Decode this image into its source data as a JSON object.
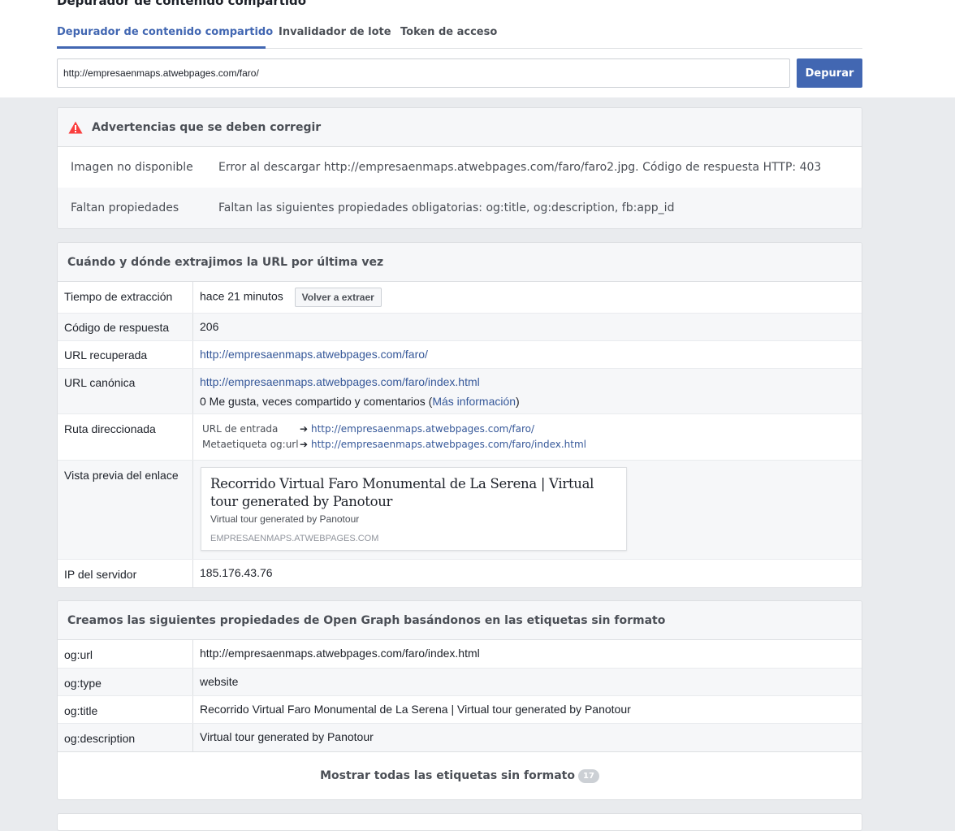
{
  "header": {
    "title": "Depurador de contenido compartido",
    "tabs": [
      {
        "label": "Depurador de contenido compartido",
        "active": true
      },
      {
        "label": "Invalidador de lote",
        "active": false
      },
      {
        "label": "Token de acceso",
        "active": false
      }
    ],
    "url_value": "http://empresaenmaps.atwebpages.com/faro/",
    "debug_button": "Depurar"
  },
  "warnings": {
    "title": "Advertencias que se deben corregir",
    "icon": "warning-triangle-icon",
    "icon_color": "#fa3e3e",
    "rows": [
      {
        "key": "Imagen no disponible",
        "value": "Error al descargar http://empresaenmaps.atwebpages.com/faro/faro2.jpg. Código de respuesta HTTP: 403"
      },
      {
        "key": "Faltan propiedades",
        "value": "Faltan las siguientes propiedades obligatorias: og:title, og:description, fb:app_id"
      }
    ]
  },
  "scrape": {
    "title": "Cuándo y dónde extrajimos la URL por última vez",
    "time_key": "Tiempo de extracción",
    "time_value": "hace 21 minutos",
    "rescrape_button": "Volver a extraer",
    "response_key": "Código de respuesta",
    "response_value": "206",
    "fetched_key": "URL recuperada",
    "fetched_value": "http://empresaenmaps.atwebpages.com/faro/",
    "canonical_key": "URL canónica",
    "canonical_value": "http://empresaenmaps.atwebpages.com/faro/index.html",
    "engagement_text": "0 Me gusta, veces compartido y comentarios (",
    "more_info_link": "Más información",
    "engagement_close": ")",
    "redirect_key": "Ruta direccionada",
    "redirects": [
      {
        "label": "URL de entrada",
        "arrow": "➔",
        "url": "http://empresaenmaps.atwebpages.com/faro/"
      },
      {
        "label": "Metaetiqueta og:url",
        "arrow": "➔",
        "url": "http://empresaenmaps.atwebpages.com/faro/index.html"
      }
    ],
    "preview_key": "Vista previa del enlace",
    "preview": {
      "title": "Recorrido Virtual Faro Monumental de La Serena | Virtual tour generated by Panotour",
      "description": "Virtual tour generated by Panotour",
      "domain": "EMPRESAENMAPS.ATWEBPAGES.COM"
    },
    "ip_key": "IP del servidor",
    "ip_value": "185.176.43.76"
  },
  "og": {
    "title": "Creamos las siguientes propiedades de Open Graph basándonos en las etiquetas sin formato",
    "rows": [
      {
        "key": "og:url",
        "value": "http://empresaenmaps.atwebpages.com/faro/index.html"
      },
      {
        "key": "og:type",
        "value": "website"
      },
      {
        "key": "og:title",
        "value": "Recorrido Virtual Faro Monumental de La Serena | Virtual tour generated by Panotour"
      },
      {
        "key": "og:description",
        "value": "Virtual tour generated by Panotour"
      }
    ],
    "show_all_label": "Mostrar todas las etiquetas sin formato",
    "show_all_count": "17"
  },
  "colors": {
    "accent": "#4267b2",
    "link": "#365899",
    "background": "#e9ebee"
  }
}
